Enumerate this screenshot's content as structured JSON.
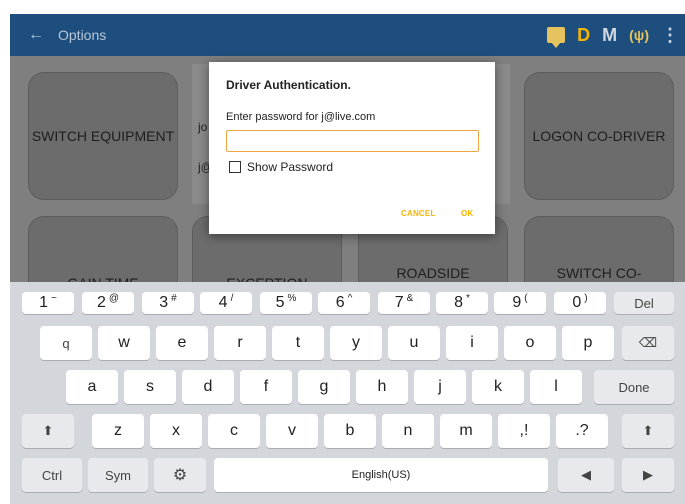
{
  "app_bar": {
    "back_icon": "←",
    "title": "Options",
    "icons": [
      "chat-icon",
      "D",
      "M",
      "signal-icon",
      "kebab-icon"
    ],
    "d_label": "D",
    "m_label": "M",
    "signal_glyph": "(ψ)",
    "kebab_glyph": "⋮"
  },
  "tiles": {
    "switch_equipment": "SWITCH EQUIPMENT",
    "logon_co_driver": "LOGON CO-DRIVER",
    "gain_time": "GAIN TIME",
    "exception": "EXCEPTION",
    "roadside": "ROADSIDE",
    "switch_co": "SWITCH CO-"
  },
  "behind": {
    "row1": "jo",
    "row2": "j@"
  },
  "dialog": {
    "title": "Driver Authentication.",
    "prompt": "Enter password for j@live.com",
    "password_value": "",
    "show_password_label": "Show Password",
    "show_password_checked": false,
    "cancel_label": "CANCEL",
    "ok_label": "OK",
    "accent_color": "#f5b400"
  },
  "keyboard": {
    "row1": [
      {
        "main": "1",
        "sup": "~"
      },
      {
        "main": "2",
        "sup": "@"
      },
      {
        "main": "3",
        "sup": "#"
      },
      {
        "main": "4",
        "sup": "/"
      },
      {
        "main": "5",
        "sup": "%"
      },
      {
        "main": "6",
        "sup": "^"
      },
      {
        "main": "7",
        "sup": "&"
      },
      {
        "main": "8",
        "sup": "*"
      },
      {
        "main": "9",
        "sup": "("
      },
      {
        "main": "0",
        "sup": ")"
      },
      {
        "main": "Del",
        "sup": ""
      }
    ],
    "row2": [
      "q",
      "w",
      "e",
      "r",
      "t",
      "y",
      "u",
      "i",
      "o",
      "p"
    ],
    "row3": [
      "a",
      "s",
      "d",
      "f",
      "g",
      "h",
      "j",
      "k",
      "l"
    ],
    "done_label": "Done",
    "row4": [
      "z",
      "x",
      "c",
      "v",
      "b",
      "n",
      "m"
    ],
    "comma_key": ",!",
    "period_key": ".?",
    "ctrl_label": "Ctrl",
    "sym_label": "Sym",
    "space_label": "English(US)",
    "settings_glyph": "⚙",
    "shift_glyph": "⬆",
    "backspace_glyph": "⌫",
    "left_glyph": "◀",
    "right_glyph": "▶"
  }
}
